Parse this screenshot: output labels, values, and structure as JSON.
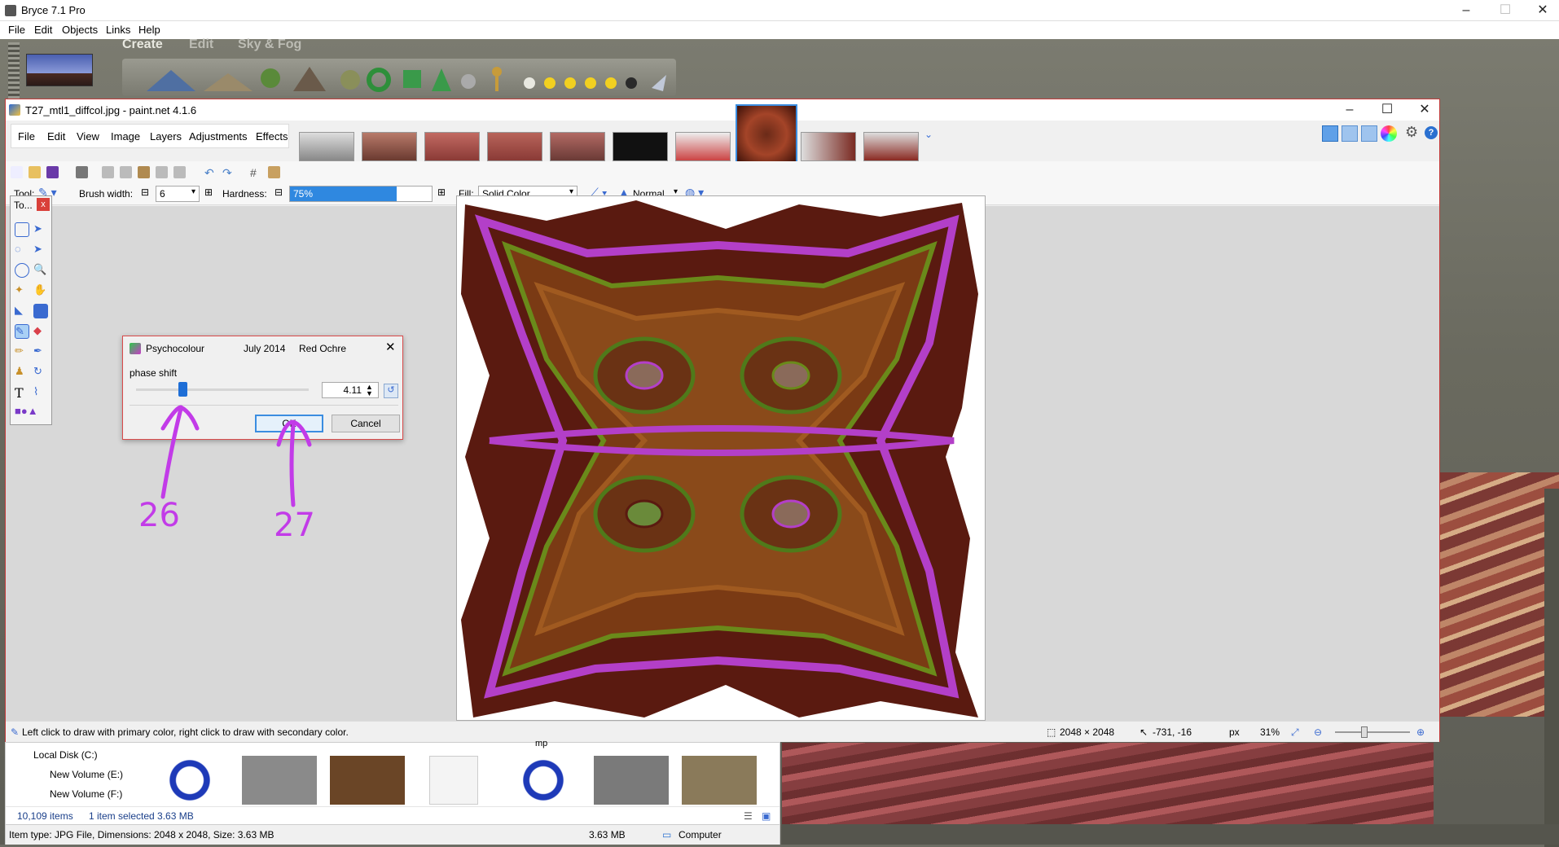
{
  "bryce": {
    "title": "Bryce 7.1  Pro",
    "menu": [
      "File",
      "Edit",
      "Objects",
      "Links",
      "Help"
    ],
    "tabs": [
      "Create",
      "Edit",
      "Sky & Fog"
    ]
  },
  "paintnet": {
    "title": "T27_mtl1_diffcol.jpg - paint.net 4.1.6",
    "menu": [
      "File",
      "Edit",
      "View",
      "Image",
      "Layers",
      "Adjustments",
      "Effects"
    ],
    "toolbar": {
      "tool_label": "Tool:",
      "brush_width_label": "Brush width:",
      "brush_width_value": "6",
      "hardness_label": "Hardness:",
      "hardness_value": "75%",
      "hardness_fraction": 0.75,
      "fill_label": "Fill:",
      "fill_value": "Solid Color",
      "blend_mode": "Normal"
    },
    "tools_palette": {
      "title": "To...",
      "close": "x"
    },
    "status": {
      "hint": "Left click to draw with primary color, right click to draw with secondary color.",
      "image_size": "2048 × 2048",
      "cursor": "-731, -16",
      "units": "px",
      "zoom": "31%"
    }
  },
  "dialog": {
    "title": "Psychocolour",
    "date": "July 2014",
    "author": "Red Ochre",
    "param_label": "phase shift",
    "value": "4.11",
    "slider_fraction": 0.27,
    "ok": "OK",
    "cancel": "Cancel"
  },
  "annotations": {
    "left": "26",
    "right": "27",
    "color": "#c23be8"
  },
  "explorer": {
    "nav": [
      "Local Disk (C:)",
      "New Volume (E:)",
      "New Volume (F:)"
    ],
    "folder_label": "mp",
    "item_count": "10,109 items",
    "selection": "1 item selected  3.63 MB",
    "item_info": "Item type: JPG File, Dimensions: 2048 x 2048, Size: 3.63 MB",
    "size": "3.63 MB",
    "location": "Computer"
  }
}
